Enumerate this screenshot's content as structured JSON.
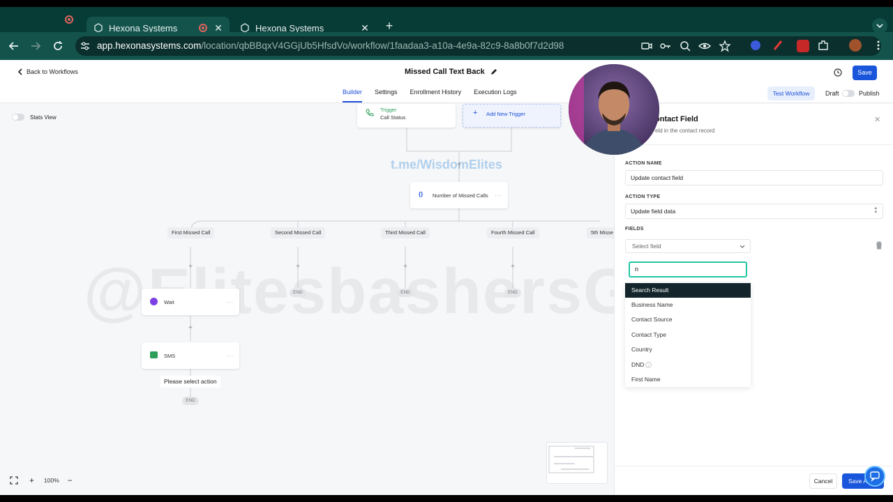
{
  "browser": {
    "tabs": [
      {
        "title": "Hexona Systems",
        "active": true
      },
      {
        "title": "Hexona Systems",
        "active": false
      }
    ],
    "url_host": "app.hexonasystems.com",
    "url_path": "/location/qbBBqxV4GGjUb5HfsdVo/workflow/1faadaa3-a10a-4e9a-82c9-8a8b0f7d2d98"
  },
  "header": {
    "back_label": "Back to Workflows",
    "title": "Missed Call Text Back",
    "tabs": [
      "Builder",
      "Settings",
      "Enrollment History",
      "Execution Logs"
    ],
    "save_label": "Save",
    "test_label": "Test Workflow",
    "draft_label": "Draft",
    "publish_label": "Publish"
  },
  "canvas": {
    "stats_label": "Stats View",
    "trigger_label": "Trigger",
    "trigger_value": "Call Status",
    "add_trigger_label": "Add New Trigger",
    "condition_label": "Number of Missed Calls",
    "branches": [
      "First Missed Call",
      "Second Missed Call",
      "Third Missed Call",
      "Fourth Missed Call",
      "5th Misse"
    ],
    "end_label": "END",
    "wait_label": "Wait",
    "sms_label": "SMS",
    "please_select": "Please select action",
    "zoom_level": "100%",
    "watermark": "@ElitesbashersGB",
    "channel_watermark": "t.me/WisdomElites"
  },
  "panel": {
    "title": "ontact Field",
    "subtitle": "eld in the contact record",
    "action_name_label": "ACTION NAME",
    "action_name_value": "Update contact field",
    "action_type_label": "ACTION TYPE",
    "action_type_value": "Update field data",
    "fields_label": "FIELDS",
    "select_placeholder": "Select field",
    "search_value": "n",
    "dropdown_header": "Search Result",
    "dropdown_items": [
      "Business Name",
      "Contact Source",
      "Contact Type",
      "Country",
      "DND",
      "First Name"
    ],
    "cancel_label": "Cancel",
    "save_action_label": "Save Action"
  },
  "colors": {
    "chrome_dark": "#073b36",
    "chrome_mid": "#13534c",
    "primary": "#1a56db",
    "dropdown_head": "#13252b",
    "focus": "#22c5a3"
  }
}
